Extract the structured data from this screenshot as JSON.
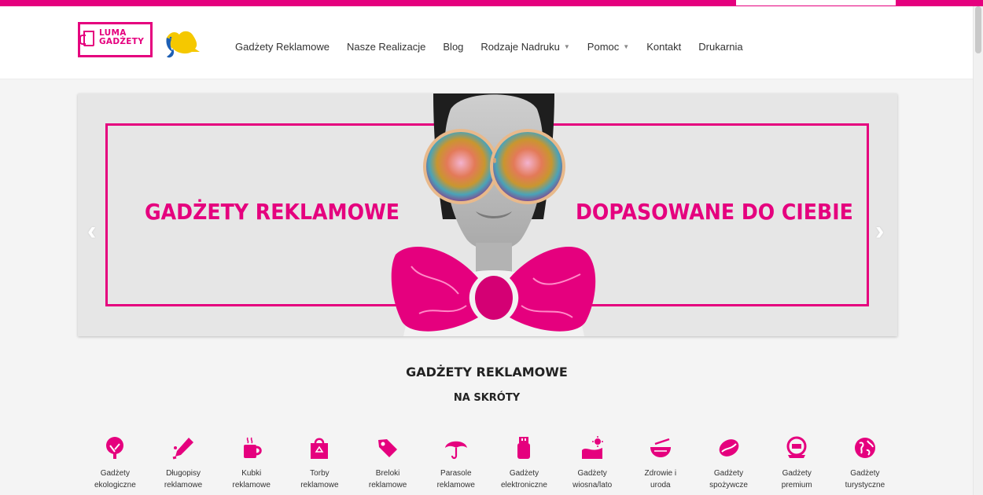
{
  "brand": {
    "logo_line1": "LUMA",
    "logo_line2": "GADŻETY",
    "accent": "#e5007e"
  },
  "nav": {
    "items": [
      {
        "label": "Gadżety Reklamowe",
        "has_dropdown": false
      },
      {
        "label": "Nasze Realizacje",
        "has_dropdown": false
      },
      {
        "label": "Blog",
        "has_dropdown": false
      },
      {
        "label": "Rodzaje Nadruku",
        "has_dropdown": true
      },
      {
        "label": "Pomoc",
        "has_dropdown": true
      },
      {
        "label": "Kontakt",
        "has_dropdown": false
      },
      {
        "label": "Drukarnia",
        "has_dropdown": false
      }
    ]
  },
  "slider": {
    "left_text": "GADŻETY REKLAMOWE",
    "right_text": "DOPASOWANE DO CIEBIE",
    "prev_icon": "chevron-left-icon",
    "next_icon": "chevron-right-icon"
  },
  "section": {
    "title": "GADŻETY REKLAMOWE",
    "subtitle": "NA SKRÓTY"
  },
  "categories": [
    {
      "line1": "Gadżety",
      "line2": "ekologiczne",
      "icon": "tree-icon"
    },
    {
      "line1": "Długopisy",
      "line2": "reklamowe",
      "icon": "pen-icon"
    },
    {
      "line1": "Kubki",
      "line2": "reklamowe",
      "icon": "mug-icon"
    },
    {
      "line1": "Torby",
      "line2": "reklamowe",
      "icon": "bag-icon"
    },
    {
      "line1": "Breloki",
      "line2": "reklamowe",
      "icon": "tag-icon"
    },
    {
      "line1": "Parasole",
      "line2": "reklamowe",
      "icon": "umbrella-icon"
    },
    {
      "line1": "Gadżety",
      "line2": "elektroniczne",
      "icon": "usb-icon"
    },
    {
      "line1": "Gadżety",
      "line2": "wiosna/lato",
      "icon": "sun-field-icon"
    },
    {
      "line1": "Zdrowie i",
      "line2": "uroda",
      "icon": "bowl-icon"
    },
    {
      "line1": "Gadżety",
      "line2": "spożywcze",
      "icon": "coffee-bean-icon"
    },
    {
      "line1": "Gadżety",
      "line2": "premium",
      "icon": "premium-badge-icon"
    },
    {
      "line1": "Gadżety",
      "line2": "turystyczne",
      "icon": "globe-icon"
    }
  ]
}
